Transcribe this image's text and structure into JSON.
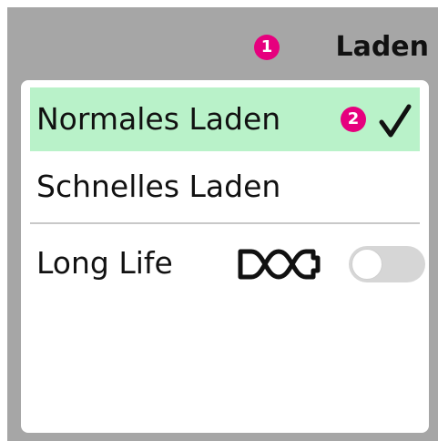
{
  "header": {
    "step_badge": "1",
    "title": "Laden"
  },
  "options": {
    "normal": {
      "label": "Normales Laden",
      "step_badge": "2",
      "selected": true,
      "selected_icon": "checkmark-icon"
    },
    "fast": {
      "label": "Schnelles Laden",
      "selected": false
    },
    "long_life": {
      "label": "Long Life",
      "icon": "battery-loop-icon",
      "toggle_on": false
    }
  },
  "colors": {
    "frame_background": "#a6a6a6",
    "selected_row": "#b9f2c9",
    "badge": "#e6007e",
    "toggle_off": "#d6d6d6"
  }
}
